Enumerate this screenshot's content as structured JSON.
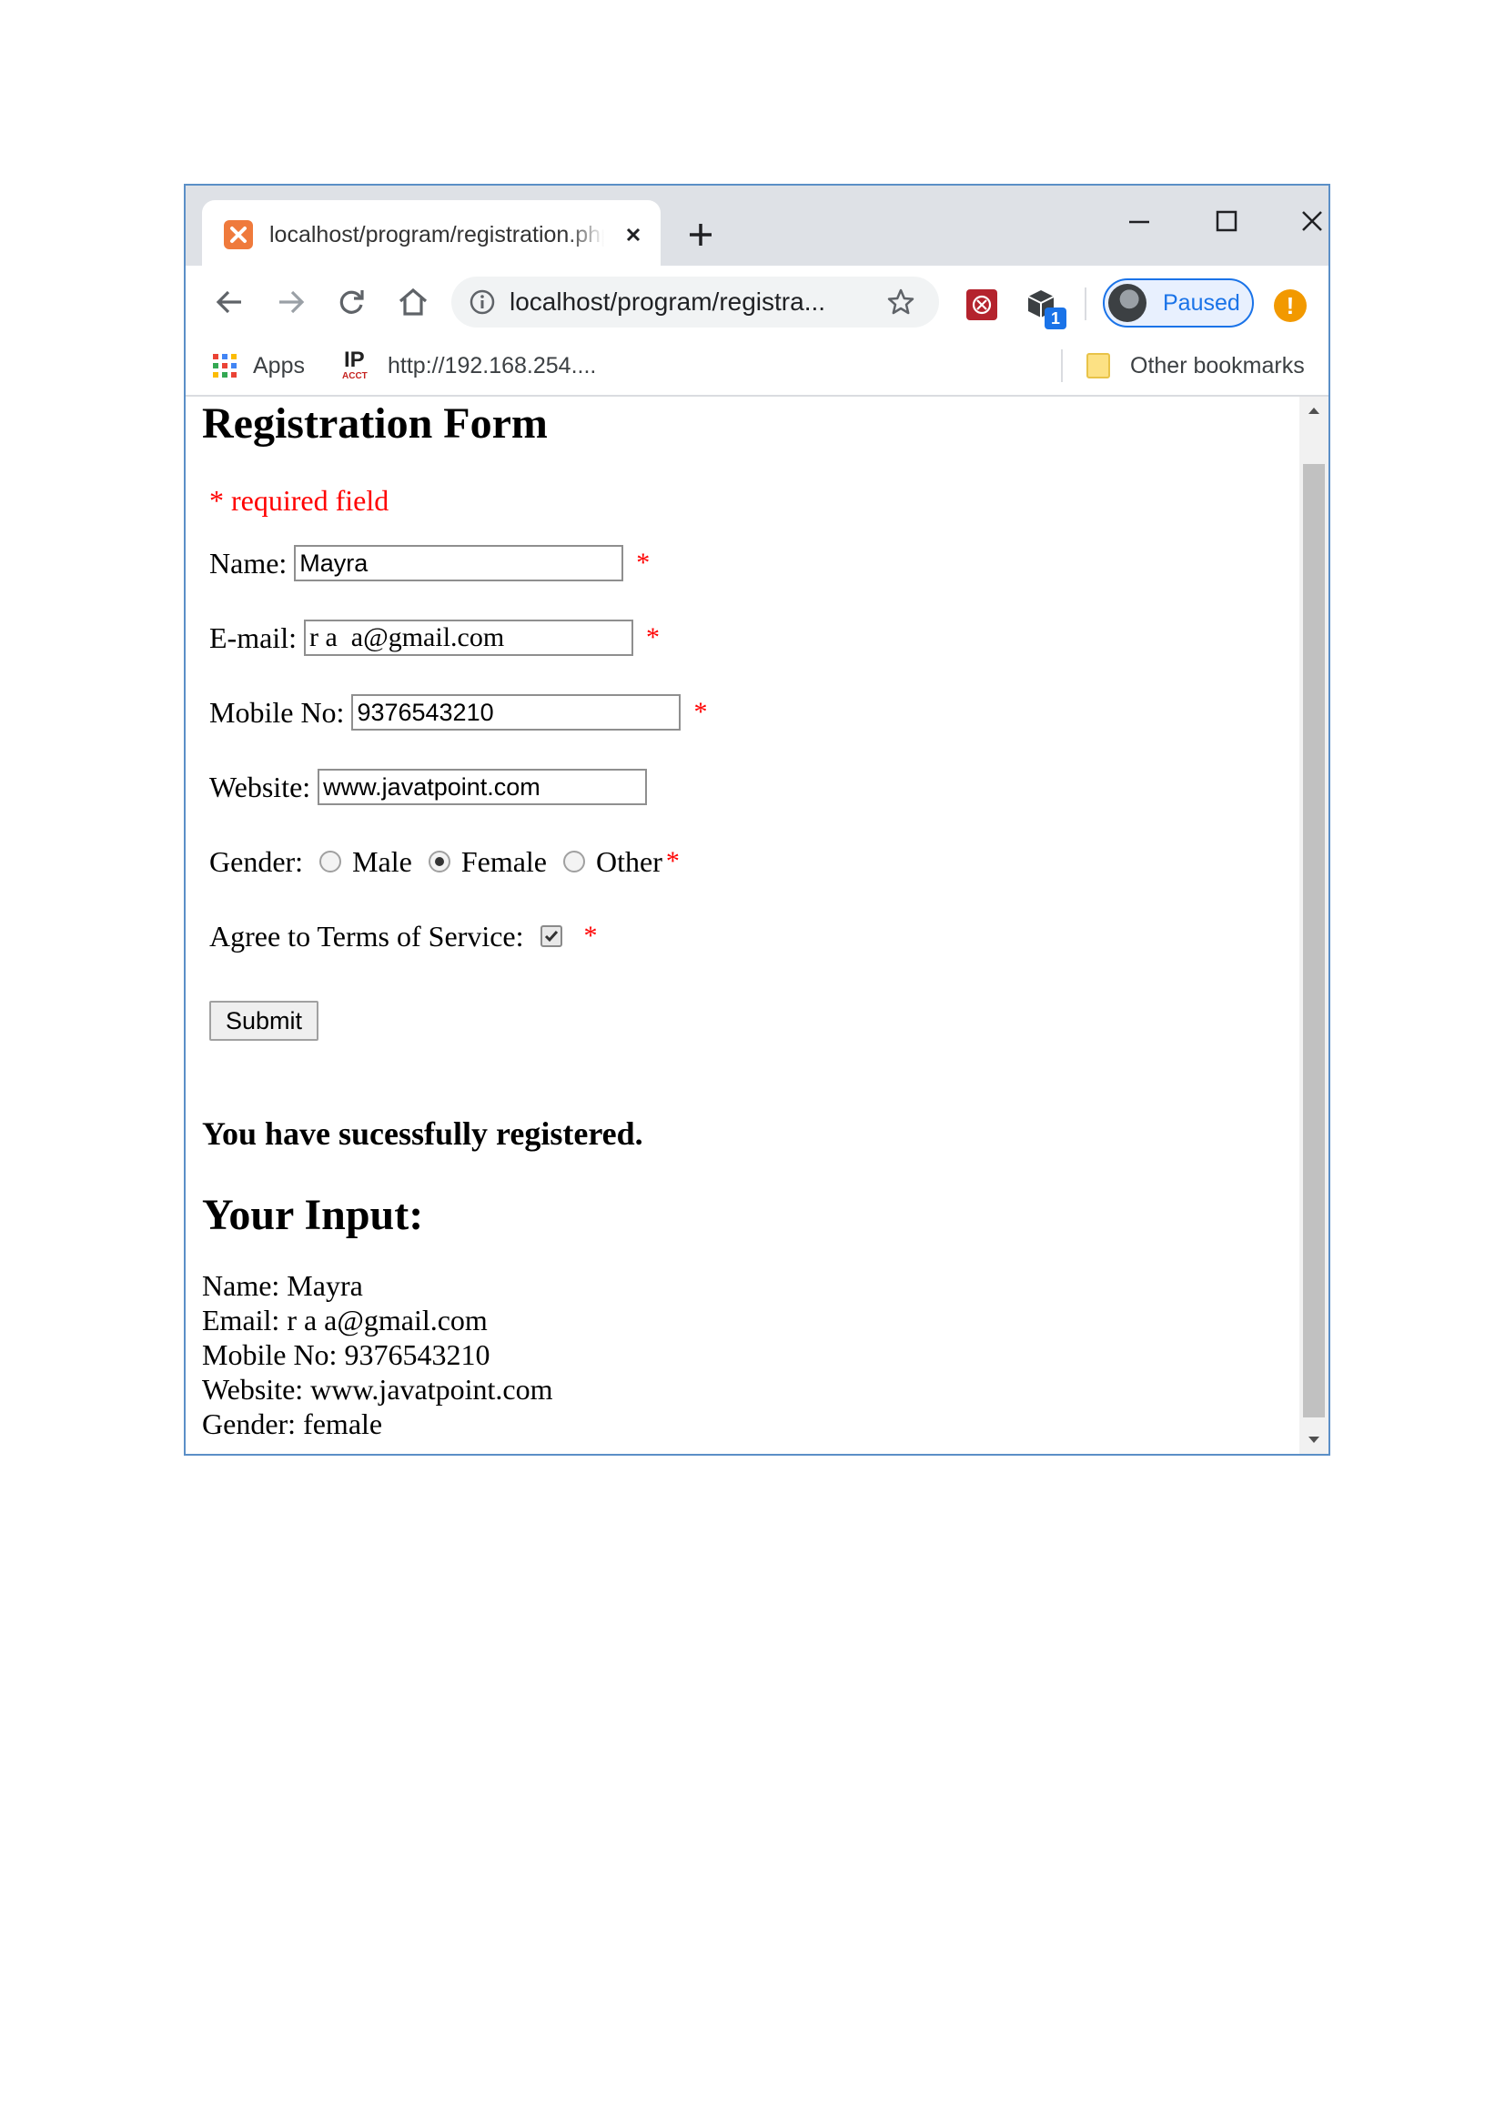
{
  "browser": {
    "tab_title": "localhost/program/registration.php",
    "new_tab_symbol": "+",
    "address": "localhost/program/registra...",
    "profile_label": "Paused",
    "extension_badge": "1",
    "update_badge": "!",
    "icons": [
      "xampp-favicon",
      "close-icon",
      "plus-icon",
      "minimize-icon",
      "maximize-icon",
      "back-icon",
      "forward-icon",
      "reload-icon",
      "home-icon",
      "info-icon",
      "star-icon",
      "extension-icon",
      "apps-icon",
      "folder-icon"
    ]
  },
  "bookmarks": {
    "apps": "Apps",
    "ip_logo": "IP",
    "ip_logo_sub": "ACCT",
    "ip_link": "http://192.168.254....",
    "other": "Other bookmarks"
  },
  "page": {
    "title": "Registration Form",
    "required_note": "* required field",
    "required_star": "*",
    "name_label": "Name:",
    "name_value": "Mayra",
    "email_label": "E-mail:",
    "email_value": "r a  a@gmail.com",
    "mobile_label": "Mobile No:",
    "mobile_value": "9376543210",
    "website_label": "Website:",
    "website_value": "www.javatpoint.com",
    "gender_label": "Gender:",
    "gender_options": [
      "Male",
      "Female",
      "Other"
    ],
    "gender_selected": "Female",
    "terms_label": "Agree to Terms of Service:",
    "terms_checked": true,
    "submit_label": "Submit",
    "success_message": "You have sucessfully registered.",
    "output_heading": "Your Input:",
    "output": {
      "name": "Name: Mayra",
      "email": "Email: r a  a@gmail.com",
      "mobile": "Mobile No: 9376543210",
      "website": "Website: www.javatpoint.com",
      "gender": "Gender: female"
    }
  },
  "colors": {
    "required": "#ff0000",
    "accent": "#1a73e8",
    "window_border": "#5b8fc7"
  }
}
